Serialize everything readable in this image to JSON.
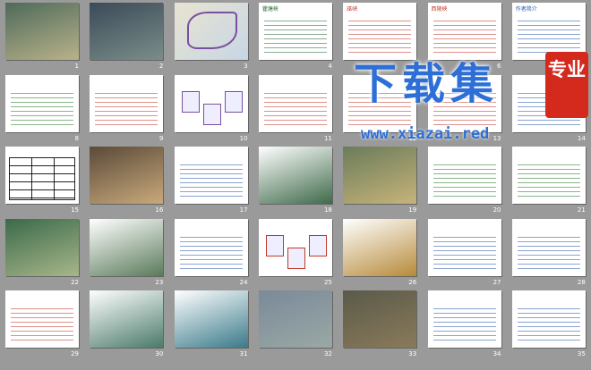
{
  "slides": [
    {
      "n": "1",
      "title": "",
      "kind": "photo",
      "c1": "#4e6a5a",
      "c2": "#b9b28a",
      "accent": "#7ab"
    },
    {
      "n": "2",
      "title": "",
      "kind": "photo",
      "c1": "#3b4a58",
      "c2": "#7b8d8a",
      "accent": "#9ab"
    },
    {
      "n": "3",
      "title": "",
      "kind": "map",
      "c1": "#e8e4d2",
      "c2": "#c7d6e4",
      "accent": "#7a4fa0"
    },
    {
      "n": "4",
      "title": "瞿塘峡",
      "kind": "text",
      "c1": "#ffffff",
      "c2": "#ffffff",
      "accent": "#2a6a3a"
    },
    {
      "n": "5",
      "title": "巫峡",
      "kind": "text",
      "c1": "#ffffff",
      "c2": "#ffffff",
      "accent": "#c0392b"
    },
    {
      "n": "6",
      "title": "西陵峡",
      "kind": "text",
      "c1": "#ffffff",
      "c2": "#ffffff",
      "accent": "#c0392b"
    },
    {
      "n": "7",
      "title": "作者简介",
      "kind": "text",
      "c1": "#ffffff",
      "c2": "#ffffff",
      "accent": "#2a5aa8"
    },
    {
      "n": "8",
      "title": "",
      "kind": "text",
      "c1": "#ffffff",
      "c2": "#ffffff",
      "accent": "#2a7a2a"
    },
    {
      "n": "9",
      "title": "",
      "kind": "text",
      "c1": "#ffffff",
      "c2": "#ffffff",
      "accent": "#c0392b"
    },
    {
      "n": "10",
      "title": "",
      "kind": "diagram",
      "c1": "#ffffff",
      "c2": "#ffffff",
      "accent": "#7a4fa0"
    },
    {
      "n": "11",
      "title": "",
      "kind": "text",
      "c1": "#ffffff",
      "c2": "#ffffff",
      "accent": "#c0392b"
    },
    {
      "n": "12",
      "title": "",
      "kind": "text",
      "c1": "#ffffff",
      "c2": "#ffffff",
      "accent": "#c0392b"
    },
    {
      "n": "13",
      "title": "",
      "kind": "text",
      "c1": "#ffffff",
      "c2": "#ffffff",
      "accent": "#c0392b"
    },
    {
      "n": "14",
      "title": "",
      "kind": "text",
      "c1": "#ffffff",
      "c2": "#ffffff",
      "accent": "#2a5aa8"
    },
    {
      "n": "15",
      "title": "",
      "kind": "table",
      "c1": "#ffffff",
      "c2": "#ffffff",
      "accent": "#2a5aa8"
    },
    {
      "n": "16",
      "title": "",
      "kind": "photo",
      "c1": "#5a4a3a",
      "c2": "#c9a97a",
      "accent": "#aaa"
    },
    {
      "n": "17",
      "title": "",
      "kind": "text",
      "c1": "#ffffff",
      "c2": "#ffffff",
      "accent": "#2a5aa8"
    },
    {
      "n": "18",
      "title": "",
      "kind": "photo",
      "c1": "#ffffff",
      "c2": "#3f6a4a",
      "accent": "#c0392b"
    },
    {
      "n": "19",
      "title": "",
      "kind": "photo",
      "c1": "#6a7c5a",
      "c2": "#c7b37a",
      "accent": "#8a6"
    },
    {
      "n": "20",
      "title": "",
      "kind": "text",
      "c1": "#ffffff",
      "c2": "#ffffff",
      "accent": "#2a7a2a"
    },
    {
      "n": "21",
      "title": "",
      "kind": "text",
      "c1": "#ffffff",
      "c2": "#ffffff",
      "accent": "#2a7a2a"
    },
    {
      "n": "22",
      "title": "",
      "kind": "photo",
      "c1": "#3a6a4a",
      "c2": "#a8b68a",
      "accent": "#9b8"
    },
    {
      "n": "23",
      "title": "",
      "kind": "photo",
      "c1": "#ffffff",
      "c2": "#5a7a5a",
      "accent": "#c0392b"
    },
    {
      "n": "24",
      "title": "",
      "kind": "text",
      "c1": "#ffffff",
      "c2": "#ffffff",
      "accent": "#2a5aa8"
    },
    {
      "n": "25",
      "title": "",
      "kind": "diagram",
      "c1": "#ffffff",
      "c2": "#ffffff",
      "accent": "#c0392b"
    },
    {
      "n": "26",
      "title": "",
      "kind": "photo",
      "c1": "#ffffff",
      "c2": "#b78a3a",
      "accent": "#c0392b"
    },
    {
      "n": "27",
      "title": "",
      "kind": "text",
      "c1": "#ffffff",
      "c2": "#ffffff",
      "accent": "#2a5aa8"
    },
    {
      "n": "28",
      "title": "",
      "kind": "text",
      "c1": "#ffffff",
      "c2": "#ffffff",
      "accent": "#2a5aa8"
    },
    {
      "n": "29",
      "title": "",
      "kind": "text",
      "c1": "#ffffff",
      "c2": "#ffffff",
      "accent": "#c0392b"
    },
    {
      "n": "30",
      "title": "",
      "kind": "photo",
      "c1": "#ffffff",
      "c2": "#4a7a6a",
      "accent": "#c0392b"
    },
    {
      "n": "31",
      "title": "",
      "kind": "photo",
      "c1": "#ffffff",
      "c2": "#3a7a8a",
      "accent": "#c0392b"
    },
    {
      "n": "32",
      "title": "",
      "kind": "photo",
      "c1": "#7a8a9a",
      "c2": "#9aa8a4",
      "accent": "#bbb"
    },
    {
      "n": "33",
      "title": "",
      "kind": "photo",
      "c1": "#5a5a4a",
      "c2": "#8a7a5a",
      "accent": "#aaa"
    },
    {
      "n": "34",
      "title": "",
      "kind": "text",
      "c1": "#ffffff",
      "c2": "#ffffff",
      "accent": "#2a5aa8"
    },
    {
      "n": "35",
      "title": "",
      "kind": "text",
      "c1": "#ffffff",
      "c2": "#ffffff",
      "accent": "#2a5aa8"
    }
  ],
  "watermark": {
    "main": "下载集",
    "badge": "专业",
    "url": "www.xiazai.red"
  }
}
